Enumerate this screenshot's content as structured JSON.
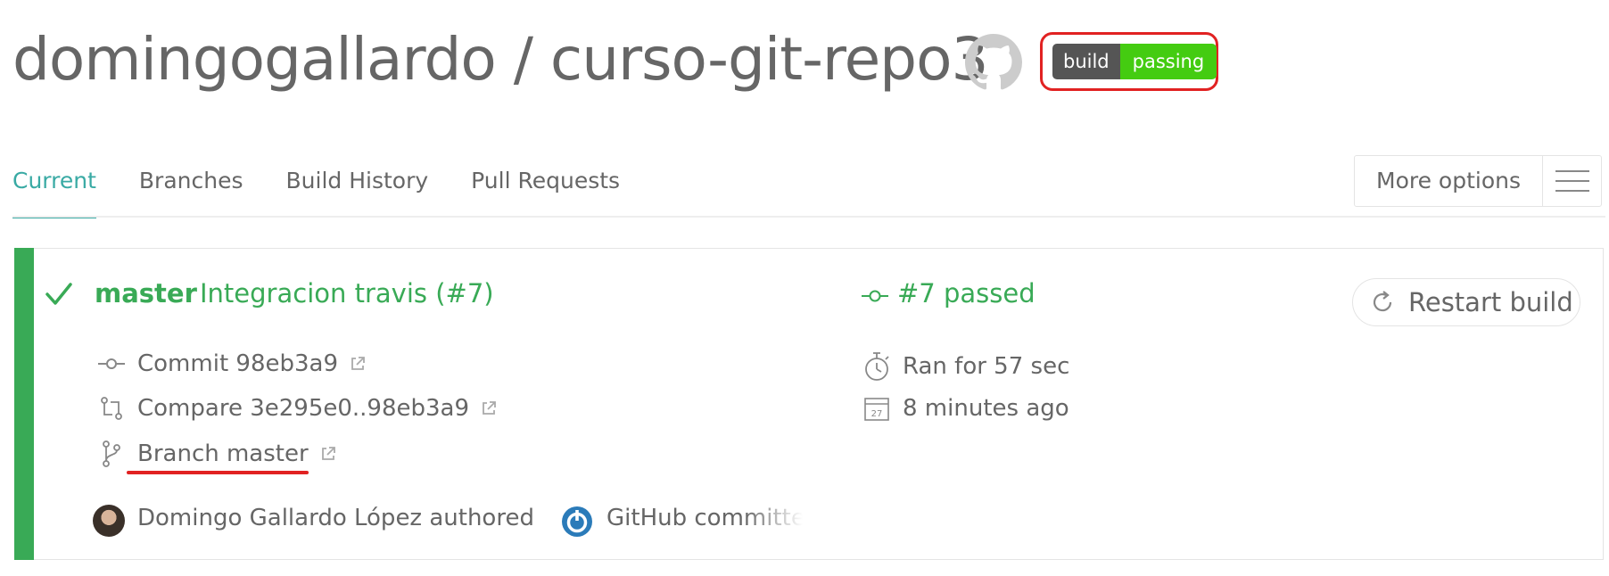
{
  "header": {
    "repo_title": "domingogallardo / curso-git-repo3",
    "badge_left": "build",
    "badge_right": "passing",
    "github_icon": "github-octocat-icon"
  },
  "tabs": [
    {
      "label": "Current",
      "active": true
    },
    {
      "label": "Branches",
      "active": false
    },
    {
      "label": "Build History",
      "active": false
    },
    {
      "label": "Pull Requests",
      "active": false
    }
  ],
  "more_options": {
    "label": "More options",
    "icon": "hamburger-icon"
  },
  "build": {
    "status": "passed",
    "branch": "master",
    "message": "Integracion travis (#7)",
    "number_status": "#7 passed",
    "restart_label": "Restart build",
    "commit": "Commit 98eb3a9",
    "compare": "Compare 3e295e0..98eb3a9",
    "branch_link": "Branch master",
    "duration": "Ran for 57 sec",
    "finished": "8 minutes ago",
    "calendar_day": "27",
    "author": "Domingo Gallardo López authored",
    "committer": "GitHub committer"
  },
  "colors": {
    "success": "#39aa56",
    "tab_active": "#39aaa4",
    "highlight": "#e12222",
    "badge_dark": "#555555",
    "badge_green": "#44cc11"
  }
}
